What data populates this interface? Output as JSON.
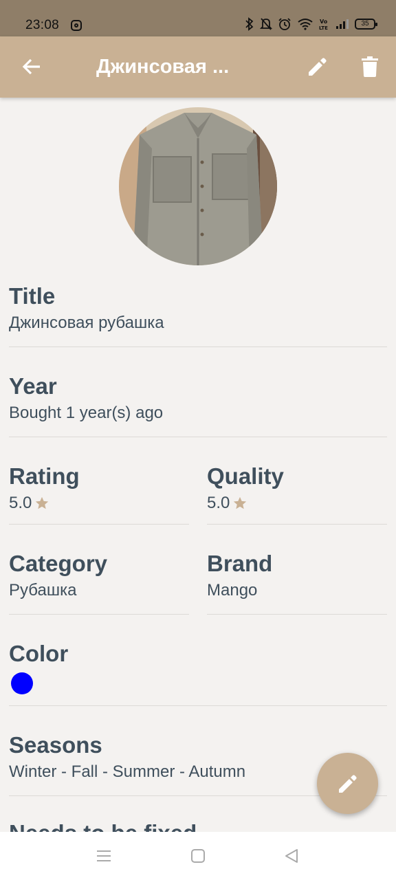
{
  "status": {
    "time": "23:08",
    "battery": "35",
    "icons": [
      "instagram-icon",
      "bluetooth-icon",
      "mute-icon",
      "alarm-icon",
      "wifi-icon",
      "volte-icon",
      "signal-icon",
      "battery-icon"
    ]
  },
  "app_bar": {
    "title": "Джинсовая ...",
    "icons": [
      "back-arrow-icon",
      "edit-pencil-icon",
      "trash-icon"
    ]
  },
  "item": {
    "title_label": "Title",
    "title_value": "Джинсовая рубашка",
    "year_label": "Year",
    "year_value": "Bought 1 year(s) ago",
    "rating_label": "Rating",
    "rating_value": "5.0",
    "quality_label": "Quality",
    "quality_value": "5.0",
    "category_label": "Category",
    "category_value": "Рубашка",
    "brand_label": "Brand",
    "brand_value": "Mango",
    "color_label": "Color",
    "color_value": "#0000ff",
    "seasons_label": "Seasons",
    "seasons_value": "Winter - Fall - Summer - Autumn",
    "needs_fix_label": "Needs to be fixed"
  },
  "colors": {
    "accent": "#c9b194",
    "status_bar": "#8f7e68",
    "star": "#c9b194",
    "text": "#3f4f5c",
    "background": "#f4f2f0"
  },
  "nav": {
    "icons": [
      "menu-icon",
      "home-square-icon",
      "back-triangle-icon"
    ]
  }
}
